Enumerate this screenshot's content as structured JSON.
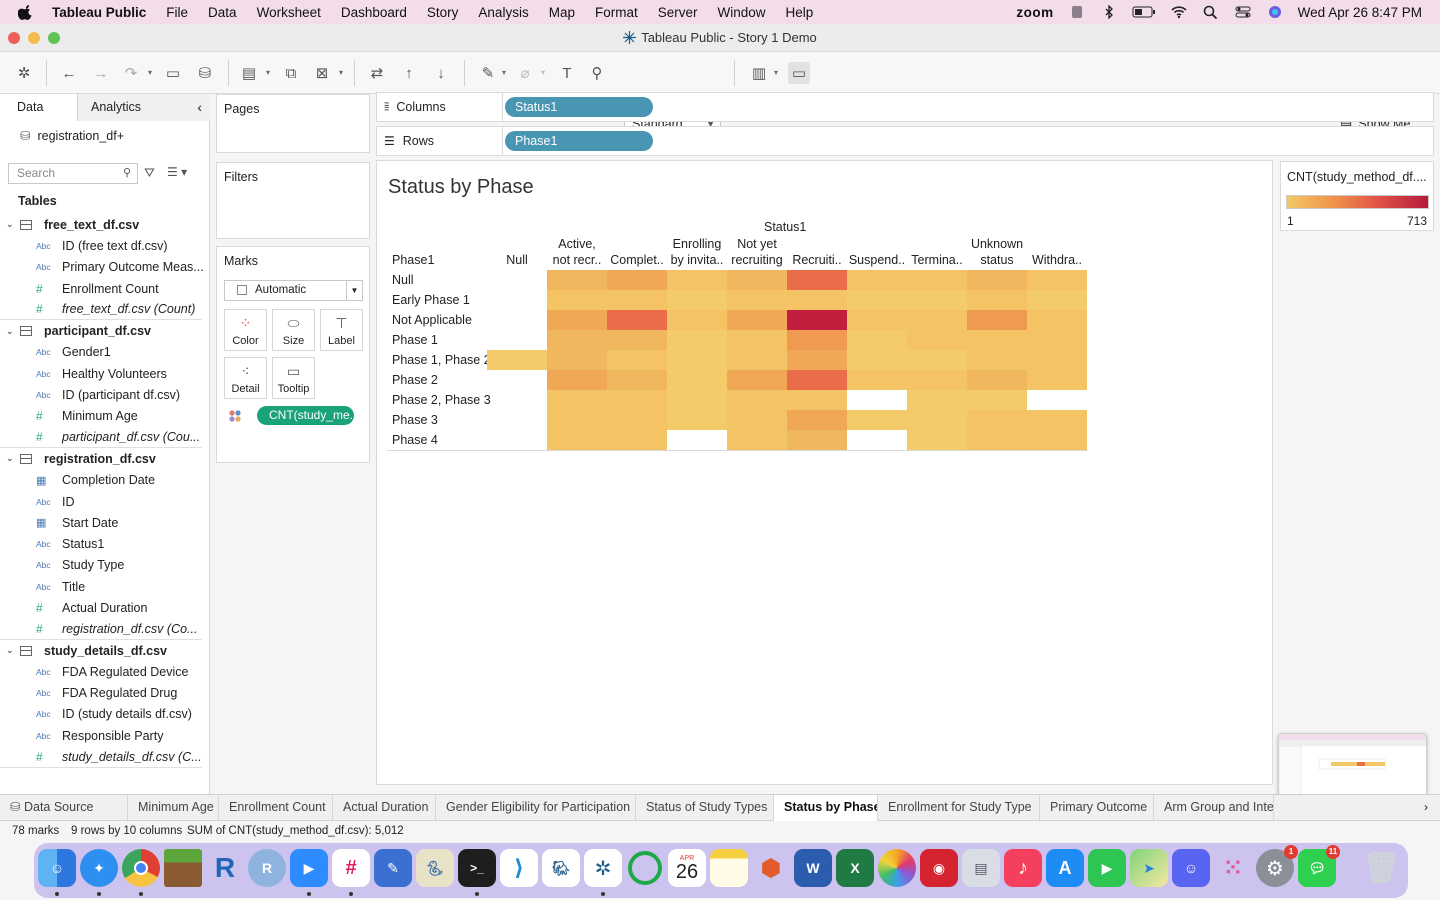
{
  "menubar": {
    "app_name": "Tableau Public",
    "items": [
      "File",
      "Data",
      "Worksheet",
      "Dashboard",
      "Story",
      "Analysis",
      "Map",
      "Format",
      "Server",
      "Window",
      "Help"
    ],
    "zoom_label": "zoom",
    "clock": "Wed Apr 26  8:47 PM"
  },
  "window": {
    "title": "Tableau Public - Story 1 Demo"
  },
  "toolbar": {
    "fit_select": "Standard",
    "show_me": "Show Me"
  },
  "data_pane": {
    "tab_data": "Data",
    "tab_analytics": "Analytics",
    "data_source": "registration_df+",
    "search_placeholder": "Search",
    "tables_title": "Tables",
    "groups": [
      {
        "name": "free_text_df.csv",
        "fields": [
          {
            "type": "Abc",
            "name": "ID (free text df.csv)",
            "italic": false
          },
          {
            "type": "Abc",
            "name": "Primary Outcome Meas...",
            "italic": false
          },
          {
            "type": "#",
            "name": "Enrollment Count",
            "italic": false
          },
          {
            "type": "#",
            "name": "free_text_df.csv (Count)",
            "italic": true
          }
        ]
      },
      {
        "name": "participant_df.csv",
        "fields": [
          {
            "type": "Abc",
            "name": "Gender1",
            "italic": false
          },
          {
            "type": "Abc",
            "name": "Healthy Volunteers",
            "italic": false
          },
          {
            "type": "Abc",
            "name": "ID (participant df.csv)",
            "italic": false
          },
          {
            "type": "#",
            "name": "Minimum Age",
            "italic": false
          },
          {
            "type": "#",
            "name": "participant_df.csv (Cou...",
            "italic": true
          }
        ]
      },
      {
        "name": "registration_df.csv",
        "fields": [
          {
            "type": "date",
            "name": "Completion Date",
            "italic": false
          },
          {
            "type": "Abc",
            "name": "ID",
            "italic": false
          },
          {
            "type": "date",
            "name": "Start Date",
            "italic": false
          },
          {
            "type": "Abc",
            "name": "Status1",
            "italic": false
          },
          {
            "type": "Abc",
            "name": "Study Type",
            "italic": false
          },
          {
            "type": "Abc",
            "name": "Title",
            "italic": false
          },
          {
            "type": "#",
            "name": "Actual Duration",
            "italic": false
          },
          {
            "type": "#",
            "name": "registration_df.csv (Co...",
            "italic": true
          }
        ]
      },
      {
        "name": "study_details_df.csv",
        "fields": [
          {
            "type": "Abc",
            "name": "FDA Regulated Device",
            "italic": false
          },
          {
            "type": "Abc",
            "name": "FDA Regulated Drug",
            "italic": false
          },
          {
            "type": "Abc",
            "name": "ID (study details df.csv)",
            "italic": false
          },
          {
            "type": "Abc",
            "name": "Responsible Party",
            "italic": false
          },
          {
            "type": "#",
            "name": "study_details_df.csv (C...",
            "italic": true
          }
        ]
      }
    ]
  },
  "cards": {
    "pages": "Pages",
    "filters": "Filters",
    "marks": "Marks",
    "marks_type": "Automatic",
    "buttons": [
      "Color",
      "Size",
      "Label",
      "Detail",
      "Tooltip"
    ],
    "color_pill": "CNT(study_me.."
  },
  "shelves": {
    "columns_label": "Columns",
    "columns_pill": "Status1",
    "rows_label": "Rows",
    "rows_pill": "Phase1"
  },
  "viz": {
    "title": "Status by Phase",
    "column_field": "Status1",
    "row_field": "Phase1",
    "columns": [
      [
        "Null"
      ],
      [
        "Active,",
        "not recr.."
      ],
      [
        "Complet.."
      ],
      [
        "Enrolling",
        "by invita.."
      ],
      [
        "Not yet",
        "recruiting"
      ],
      [
        "Recruiti.."
      ],
      [
        "Suspend.."
      ],
      [
        "Termina.."
      ],
      [
        "Unknown",
        "status"
      ],
      [
        "Withdra.."
      ]
    ],
    "rows": [
      "Null",
      "Early Phase 1",
      "Not Applicable",
      "Phase 1",
      "Phase 1, Phase 2",
      "Phase 2",
      "Phase 2, Phase 3",
      "Phase 3",
      "Phase 4"
    ],
    "colors": {
      "empty": "#ffffff",
      "l1": "#f3cb68",
      "l2": "#f3c364",
      "l3": "#f1b75e",
      "l4": "#f0a857",
      "l5": "#ef9a50",
      "l6": "#e96d49",
      "l7": "#c11f3d"
    },
    "cells": [
      [
        "empty",
        "l3",
        "l4",
        "l2",
        "l3",
        "l6",
        "l2",
        "l2",
        "l3",
        "l2"
      ],
      [
        "empty",
        "l2",
        "l2",
        "l1",
        "l2",
        "l2",
        "l1",
        "l1",
        "l2",
        "l1"
      ],
      [
        "empty",
        "l4",
        "l6",
        "l2",
        "l4",
        "l7",
        "l2",
        "l2",
        "l5",
        "l2"
      ],
      [
        "empty",
        "l3",
        "l3",
        "l1",
        "l2",
        "l5",
        "l1",
        "l2",
        "l2",
        "l2"
      ],
      [
        "l1",
        "l3",
        "l2",
        "l1",
        "l2",
        "l4",
        "l1",
        "l1",
        "l2",
        "l2"
      ],
      [
        "empty",
        "l4",
        "l3",
        "l1",
        "l4",
        "l6",
        "l2",
        "l2",
        "l3",
        "l2"
      ],
      [
        "empty",
        "l2",
        "l2",
        "l1",
        "l2",
        "l2",
        "empty",
        "l1",
        "l1",
        "empty"
      ],
      [
        "empty",
        "l2",
        "l2",
        "l1",
        "l2",
        "l4",
        "l1",
        "l1",
        "l2",
        "l2"
      ],
      [
        "empty",
        "l2",
        "l2",
        "empty",
        "l2",
        "l3",
        "empty",
        "l1",
        "l2",
        "l2"
      ]
    ]
  },
  "legend": {
    "title": "CNT(study_method_df....",
    "min": "1",
    "max": "713"
  },
  "sheet_tabs": {
    "data_source": "Data Source",
    "tabs": [
      "Minimum Age",
      "Enrollment Count",
      "Actual Duration",
      "Gender Eligibility for Participation",
      "Status of Study Types",
      "Status by Phase",
      "Enrollment for Study Type",
      "Primary Outcome",
      "Arm Group and Inter"
    ],
    "active": "Status by Phase"
  },
  "statusbar": {
    "marks": "78 marks",
    "dims": "9 rows by 10 columns",
    "sum": "SUM of CNT(study_method_df.csv): 5,012"
  },
  "dock": {
    "calendar_month": "APR",
    "calendar_day": "26",
    "badges": [
      "1",
      "11"
    ]
  }
}
